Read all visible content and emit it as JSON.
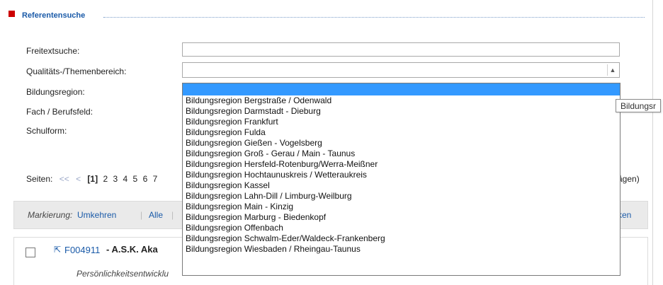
{
  "section": {
    "title": "Referentensuche"
  },
  "form": {
    "freitext_label": "Freitextsuche:",
    "freitext_value": "",
    "qualitaet_label": "Qualitäts-/Themenbereich:",
    "qualitaet_value": "",
    "bildungsregion_label": "Bildungsregion:",
    "fach_label": "Fach / Berufsfeld:",
    "schulform_label": "Schulform:"
  },
  "dropdown": {
    "items": [
      "",
      "Bildungsregion Bergstraße / Odenwald",
      "Bildungsregion Darmstadt - Dieburg",
      "Bildungsregion Frankfurt",
      "Bildungsregion Fulda",
      "Bildungsregion Gießen - Vogelsberg",
      "Bildungsregion Groß - Gerau / Main - Taunus",
      "Bildungsregion Hersfeld-Rotenburg/Werra-Meißner",
      "Bildungsregion Hochtaunuskreis / Wetteraukreis",
      "Bildungsregion Kassel",
      "Bildungsregion Lahn-Dill / Limburg-Weilburg",
      "Bildungsregion Main - Kinzig",
      "Bildungsregion Marburg - Biedenkopf",
      "Bildungsregion Offenbach",
      "Bildungsregion Schwalm-Eder/Waldeck-Frankenberg",
      "Bildungsregion Wiesbaden / Rheingau-Taunus"
    ],
    "highlight_color": "#3399ff"
  },
  "tooltip": {
    "text": "Bildungsr"
  },
  "pager": {
    "label": "Seiten:",
    "first": "<<",
    "prev": "<",
    "current": "[1]",
    "pages": [
      "2",
      "3",
      "4",
      "5",
      "6",
      "7"
    ],
    "trailing": "ägen)"
  },
  "marking": {
    "label": "Markierung:",
    "invert": "Umkehren",
    "all": "Alle",
    "sep": "|",
    "right_link": "ken"
  },
  "result": {
    "id": "F004911",
    "dash": "-",
    "title": "A.S.K. Aka",
    "subtitle": "Persönlichkeitsentwicklu"
  },
  "colors": {
    "accent": "#1a5aa8",
    "marker": "#cc0000"
  }
}
